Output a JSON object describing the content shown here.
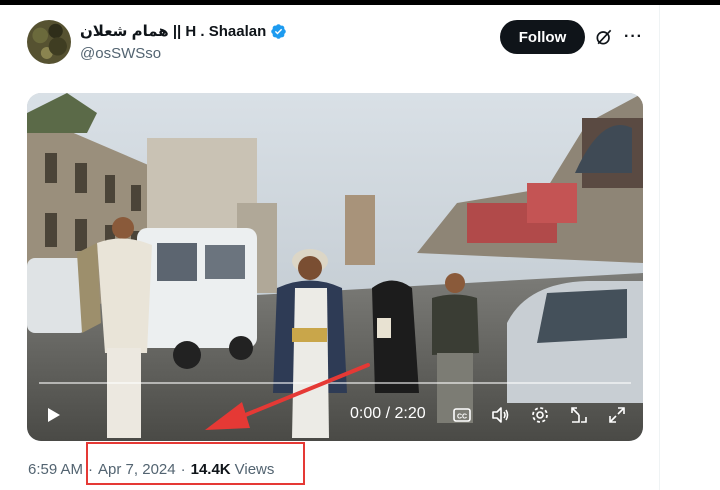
{
  "tweet": {
    "author": {
      "display_name": "همام شعلان || H . Shaalan",
      "handle": "@osSWSso",
      "verified": true
    },
    "follow_label": "Follow",
    "video": {
      "time_display": "0:00 / 2:20",
      "progress": 0
    },
    "meta": {
      "time": "6:59 AM",
      "date": "Apr 7, 2024",
      "views_count": "14.4K",
      "views_label": "Views"
    }
  },
  "colors": {
    "accent": "#0f1419",
    "verified": "#1d9bf0",
    "secondary_text": "#536471",
    "annotation": "#e53935"
  },
  "icons": [
    "verified-badge-icon",
    "grok-icon",
    "more-icon",
    "play-icon",
    "captions-icon",
    "volume-icon",
    "settings-icon",
    "pip-icon",
    "fullscreen-icon"
  ]
}
